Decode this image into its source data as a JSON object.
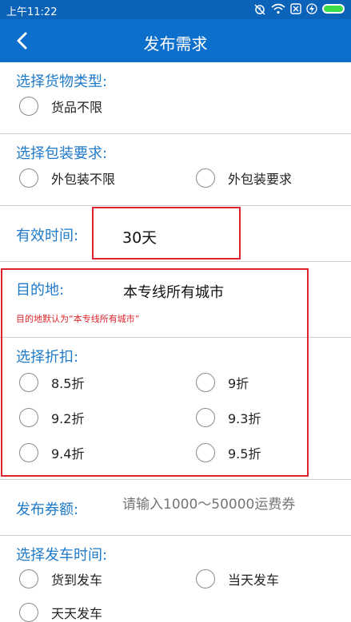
{
  "status_bar": {
    "time": "上午11:22"
  },
  "header": {
    "title": "发布需求"
  },
  "goods_type": {
    "label": "选择货物类型:",
    "options": [
      "货品不限"
    ]
  },
  "packaging": {
    "label": "选择包装要求:",
    "options": [
      "外包装不限",
      "外包装要求"
    ]
  },
  "valid_time": {
    "label": "有效时间:",
    "value": "30天"
  },
  "destination": {
    "label": "目的地:",
    "value": "本专线所有城市",
    "hint": "目的地默认为“本专线所有城市”"
  },
  "discount": {
    "label": "选择折扣:",
    "options": [
      "8.5折",
      "9折",
      "9.2折",
      "9.3折",
      "9.4折",
      "9.5折"
    ]
  },
  "voucher": {
    "label": "发布券额:",
    "placeholder": "请输入1000～50000运费券"
  },
  "departure": {
    "label": "选择发车时间:",
    "options": [
      "货到发车",
      "当天发车",
      "天天发车"
    ]
  },
  "colors": {
    "primary": "#0c6fcc",
    "label_blue": "#1f7ac9",
    "highlight_red": "#d9252b"
  }
}
